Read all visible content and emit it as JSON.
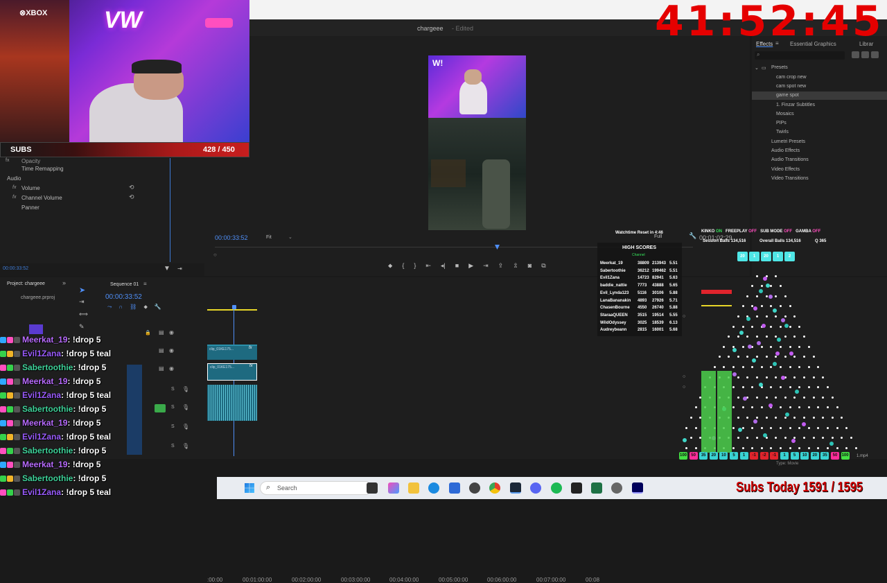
{
  "timer": "41:52:45",
  "subs": {
    "label": "SUBS",
    "count": "428 / 450"
  },
  "premiere": {
    "title": "chargeee",
    "edited": "- Edited",
    "sequence_tab": "Sequence 01",
    "effect_controls": {
      "opacity": "Opacity",
      "time_remap": "Time Remapping",
      "audio": "Audio",
      "volume": "Volume",
      "channel_volume": "Channel Volume",
      "panner": "Panner",
      "fx": "fx",
      "timecode": "00:00:33:52"
    },
    "program": {
      "timecode": "00:00:33:52",
      "fit": "Fit",
      "full": "Full",
      "duration": "00:01:02:29"
    },
    "effects_panel": {
      "tabs": [
        "Effects",
        "Essential Graphics",
        "Librar"
      ],
      "tree": [
        "Presets",
        "cam crop new",
        "cam spot new",
        "game spot",
        "1. Finzar Subtitles",
        "Mosaics",
        "PIPs",
        "Twirls",
        "Lumetri Presets",
        "Audio Effects",
        "Audio Transitions",
        "Video Effects",
        "Video Transitions"
      ]
    },
    "project": {
      "tab": "Project: chargeee",
      "file": "chargeee.prproj"
    },
    "timeline": {
      "tab": "Sequence 01",
      "timecode": "00:00:33:52",
      "ruler": [
        ":00:00",
        "00:01:00:00",
        "00:02:00:00",
        "00:03:00:00",
        "00:04:00:00",
        "00:05:00:00",
        "00:06:00:00",
        "00:07:00:00",
        "00:08"
      ],
      "clip_label": "clip_01KE175...",
      "fx": "fx"
    },
    "type_label": "Type: Movie",
    "file_ext": "1.mp4"
  },
  "overlay": {
    "watchtime": "Watchtime Reset in 4:46",
    "status": [
      {
        "k": "KINKO",
        "v": "ON"
      },
      {
        "k": "FREEPLAY",
        "v": "OFF"
      },
      {
        "k": "SUB MODE",
        "v": "OFF"
      },
      {
        "k": "GAMBA",
        "v": "OFF"
      }
    ],
    "session": "Session Balls  134,516",
    "overall": "Overall Balls  134,516",
    "q": "Q  365",
    "hs_title": "HIGH SCORES",
    "hs_sub": "Channel",
    "scores": [
      {
        "name": "Meerkat_19",
        "a": "38809",
        "b": "213943",
        "c": "5.51"
      },
      {
        "name": "Sabertoothie",
        "a": "36212",
        "b": "199462",
        "c": "5.51"
      },
      {
        "name": "Evil1Zana",
        "a": "14723",
        "b": "82941",
        "c": "5.63"
      },
      {
        "name": "baddie_nattie",
        "a": "7773",
        "b": "43888",
        "c": "5.65"
      },
      {
        "name": "Evil_Lynda123",
        "a": "5116",
        "b": "30106",
        "c": "5.88"
      },
      {
        "name": "LanaBananakin",
        "a": "4893",
        "b": "27926",
        "c": "5.71"
      },
      {
        "name": "ChasenBourne",
        "a": "4550",
        "b": "26740",
        "c": "5.88"
      },
      {
        "name": "StaraaQUEEN",
        "a": "3515",
        "b": "19514",
        "c": "5.55"
      },
      {
        "name": "WildOdyssey",
        "a": "3025",
        "b": "18539",
        "c": "6.13"
      },
      {
        "name": "Audreybeann",
        "a": "2815",
        "b": "16001",
        "c": "5.68"
      }
    ],
    "top_buckets": [
      "20",
      "1",
      "20",
      "1",
      "2"
    ],
    "buckets": [
      "100",
      "50",
      "35",
      "20",
      "10",
      "5",
      "1",
      "-1",
      "-2",
      "-1",
      "1",
      "5",
      "10",
      "20",
      "35",
      "50",
      "100"
    ]
  },
  "chat": [
    {
      "user": "Meerkat_19",
      "msg": ": !drop 5",
      "color": "#b96cff"
    },
    {
      "user": "Evil1Zana",
      "msg": ": !drop 5 teal",
      "color": "#9b5cff"
    },
    {
      "user": "Sabertoothie",
      "msg": ": !drop 5",
      "color": "#3fd39a"
    },
    {
      "user": "Meerkat_19",
      "msg": ": !drop 5",
      "color": "#b96cff"
    },
    {
      "user": "Evil1Zana",
      "msg": ": !drop 5 teal",
      "color": "#9b5cff"
    },
    {
      "user": "Sabertoothie",
      "msg": ": !drop 5",
      "color": "#3fd39a"
    },
    {
      "user": "Meerkat_19",
      "msg": ": !drop 5",
      "color": "#b96cff"
    },
    {
      "user": "Evil1Zana",
      "msg": ": !drop 5 teal",
      "color": "#9b5cff"
    },
    {
      "user": "Sabertoothie",
      "msg": ": !drop 5",
      "color": "#3fd39a"
    },
    {
      "user": "Meerkat_19",
      "msg": ": !drop 5",
      "color": "#b96cff"
    },
    {
      "user": "Sabertoothie",
      "msg": ": !drop 5",
      "color": "#3fd39a"
    },
    {
      "user": "Evil1Zana",
      "msg": ": !drop 5 teal",
      "color": "#9b5cff"
    }
  ],
  "taskbar": {
    "search": "Search"
  },
  "subs_today": "Subs Today 1591 / 1595"
}
